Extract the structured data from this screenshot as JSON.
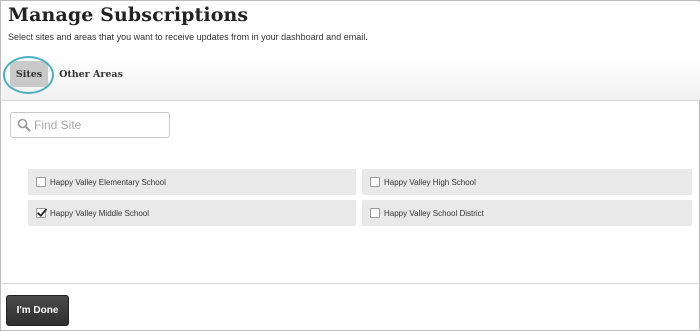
{
  "page": {
    "title": "Manage Subscriptions",
    "subtitle": "Select sites and areas that you want to receive updates from in your dashboard and email."
  },
  "tabs": [
    {
      "label": "Sites",
      "active": true
    },
    {
      "label": "Other Areas",
      "active": false
    }
  ],
  "search": {
    "placeholder": "Find Site",
    "value": ""
  },
  "sites": [
    {
      "label": "Happy Valley Elementary School",
      "checked": false
    },
    {
      "label": "Happy Valley High School",
      "checked": false
    },
    {
      "label": "Happy Valley Middle School",
      "checked": true
    },
    {
      "label": "Happy Valley School District",
      "checked": false
    }
  ],
  "footer": {
    "done_label": "I'm Done"
  },
  "colors": {
    "highlight_ring": "#4ab0c1",
    "active_tab": "#c9c9c9",
    "done_button": "#3a3a3a"
  }
}
